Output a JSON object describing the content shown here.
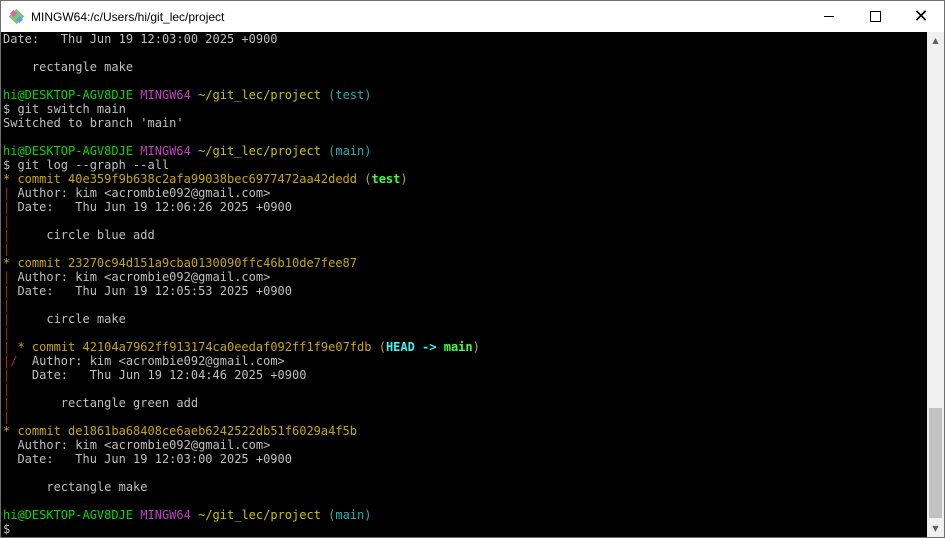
{
  "window": {
    "title": "MINGW64:/c/Users/hi/git_lec/project",
    "controls": {
      "minimize": "",
      "maximize": "",
      "close": "✕"
    }
  },
  "terminal": {
    "lines": [
      [
        {
          "t": "Date:   Thu Jun 19 12:03:00 2025 +0900",
          "c": ""
        }
      ],
      [
        {
          "t": "",
          "c": ""
        }
      ],
      [
        {
          "t": "    rectangle make",
          "c": ""
        }
      ],
      [
        {
          "t": "",
          "c": ""
        }
      ],
      [
        {
          "t": "hi@DESKTOP-AGV8DJE",
          "c": "green"
        },
        {
          "t": " ",
          "c": ""
        },
        {
          "t": "MINGW64",
          "c": "magenta"
        },
        {
          "t": " ",
          "c": ""
        },
        {
          "t": "~/git_lec/project",
          "c": "yellow"
        },
        {
          "t": " ",
          "c": ""
        },
        {
          "t": "(test)",
          "c": "cyan"
        }
      ],
      [
        {
          "t": "$ git switch main",
          "c": ""
        }
      ],
      [
        {
          "t": "Switched to branch 'main'",
          "c": ""
        }
      ],
      [
        {
          "t": "",
          "c": ""
        }
      ],
      [
        {
          "t": "hi@DESKTOP-AGV8DJE",
          "c": "green"
        },
        {
          "t": " ",
          "c": ""
        },
        {
          "t": "MINGW64",
          "c": "magenta"
        },
        {
          "t": " ",
          "c": ""
        },
        {
          "t": "~/git_lec/project",
          "c": "yellow"
        },
        {
          "t": " ",
          "c": ""
        },
        {
          "t": "(main)",
          "c": "cyan"
        }
      ],
      [
        {
          "t": "$ git log --graph --all",
          "c": ""
        }
      ],
      [
        {
          "t": "* ",
          "c": "gold"
        },
        {
          "t": "commit 40e359f9b638c2afa99038bec6977472aa42dedd",
          "c": "gold"
        },
        {
          "t": " (",
          "c": "gold"
        },
        {
          "t": "test",
          "c": "bgreen"
        },
        {
          "t": ")",
          "c": "gold"
        }
      ],
      [
        {
          "t": "|",
          "c": "red"
        },
        {
          "t": " Author: kim <acrombie092@gmail.com>",
          "c": ""
        }
      ],
      [
        {
          "t": "|",
          "c": "red"
        },
        {
          "t": " Date:   Thu Jun 19 12:06:26 2025 +0900",
          "c": ""
        }
      ],
      [
        {
          "t": "|",
          "c": "red"
        }
      ],
      [
        {
          "t": "|",
          "c": "red"
        },
        {
          "t": "     circle blue add",
          "c": ""
        }
      ],
      [
        {
          "t": "|",
          "c": "red"
        }
      ],
      [
        {
          "t": "* ",
          "c": "gold"
        },
        {
          "t": "commit 23270c94d151a9cba0130090ffc46b10de7fee87",
          "c": "gold"
        }
      ],
      [
        {
          "t": "|",
          "c": "red"
        },
        {
          "t": " Author: kim <acrombie092@gmail.com>",
          "c": ""
        }
      ],
      [
        {
          "t": "|",
          "c": "red"
        },
        {
          "t": " Date:   Thu Jun 19 12:05:53 2025 +0900",
          "c": ""
        }
      ],
      [
        {
          "t": "|",
          "c": "red"
        }
      ],
      [
        {
          "t": "|",
          "c": "red"
        },
        {
          "t": "     circle make",
          "c": ""
        }
      ],
      [
        {
          "t": "|",
          "c": "red"
        }
      ],
      [
        {
          "t": "|",
          "c": "red"
        },
        {
          "t": " * ",
          "c": "gold"
        },
        {
          "t": "commit 42104a7962ff913174ca0eedaf092ff1f9e07fdb",
          "c": "gold"
        },
        {
          "t": " (",
          "c": "gold"
        },
        {
          "t": "HEAD -> ",
          "c": "bcyan"
        },
        {
          "t": "main",
          "c": "bgreen"
        },
        {
          "t": ")",
          "c": "gold"
        }
      ],
      [
        {
          "t": "|/",
          "c": "red"
        },
        {
          "t": "  Author: kim <acrombie092@gmail.com>",
          "c": ""
        }
      ],
      [
        {
          "t": "|",
          "c": "red"
        },
        {
          "t": "   Date:   Thu Jun 19 12:04:46 2025 +0900",
          "c": ""
        }
      ],
      [
        {
          "t": "|",
          "c": "red"
        }
      ],
      [
        {
          "t": "|",
          "c": "red"
        },
        {
          "t": "       rectangle green add",
          "c": ""
        }
      ],
      [
        {
          "t": "|",
          "c": "red"
        }
      ],
      [
        {
          "t": "* ",
          "c": "gold"
        },
        {
          "t": "commit de1861ba68408ce6aeb6242522db51f6029a4f5b",
          "c": "gold"
        }
      ],
      [
        {
          "t": "  Author: kim <acrombie092@gmail.com>",
          "c": ""
        }
      ],
      [
        {
          "t": "  Date:   Thu Jun 19 12:03:00 2025 +0900",
          "c": ""
        }
      ],
      [
        {
          "t": "",
          "c": ""
        }
      ],
      [
        {
          "t": "      rectangle make",
          "c": ""
        }
      ],
      [
        {
          "t": "",
          "c": ""
        }
      ],
      [
        {
          "t": "hi@DESKTOP-AGV8DJE",
          "c": "green"
        },
        {
          "t": " ",
          "c": ""
        },
        {
          "t": "MINGW64",
          "c": "magenta"
        },
        {
          "t": " ",
          "c": ""
        },
        {
          "t": "~/git_lec/project",
          "c": "yellow"
        },
        {
          "t": " ",
          "c": ""
        },
        {
          "t": "(main)",
          "c": "cyan"
        }
      ],
      [
        {
          "t": "$",
          "c": ""
        }
      ]
    ]
  },
  "scrollbar": {
    "up": "▲",
    "down": "▼"
  },
  "colors": {
    "green": "#00d800",
    "magenta": "#c040c0",
    "yellow": "#c8c400",
    "cyan": "#18b2b2",
    "gold": "#c6a700",
    "red": "#c02020",
    "bcyan": "#40f0f0",
    "bgreen": "#40ff40",
    "text": "#bfbfbf"
  }
}
